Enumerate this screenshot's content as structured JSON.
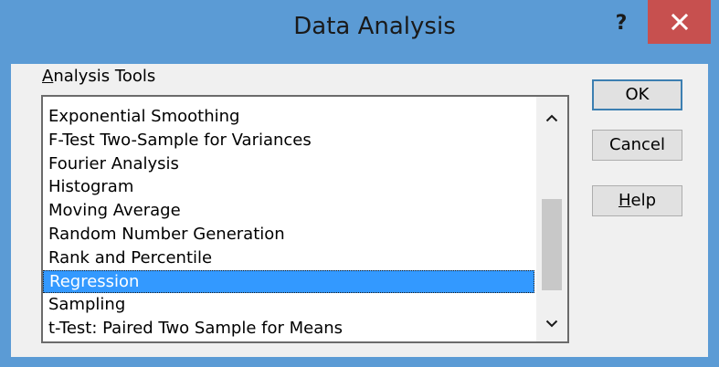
{
  "dialog": {
    "title": "Data Analysis",
    "help_glyph": "?",
    "close_glyph": "✕"
  },
  "tools": {
    "label_accel": "A",
    "label_rest": "nalysis Tools",
    "items": [
      {
        "label": "Exponential Smoothing"
      },
      {
        "label": "F-Test Two-Sample for Variances"
      },
      {
        "label": "Fourier Analysis"
      },
      {
        "label": "Histogram"
      },
      {
        "label": "Moving Average"
      },
      {
        "label": "Random Number Generation"
      },
      {
        "label": "Rank and Percentile"
      },
      {
        "label": "Regression",
        "selected": true
      },
      {
        "label": "Sampling"
      },
      {
        "label": "t-Test: Paired Two Sample for Means"
      }
    ],
    "selected_value": "Regression",
    "scroll_position": 0.55
  },
  "buttons": {
    "ok": "OK",
    "cancel": "Cancel",
    "help_accel": "H",
    "help_rest": "elp"
  },
  "colors": {
    "title_bar": "#5b9bd5",
    "close_button": "#c7504f",
    "selection": "#3399ff",
    "dialog_body": "#f0f0f0"
  }
}
